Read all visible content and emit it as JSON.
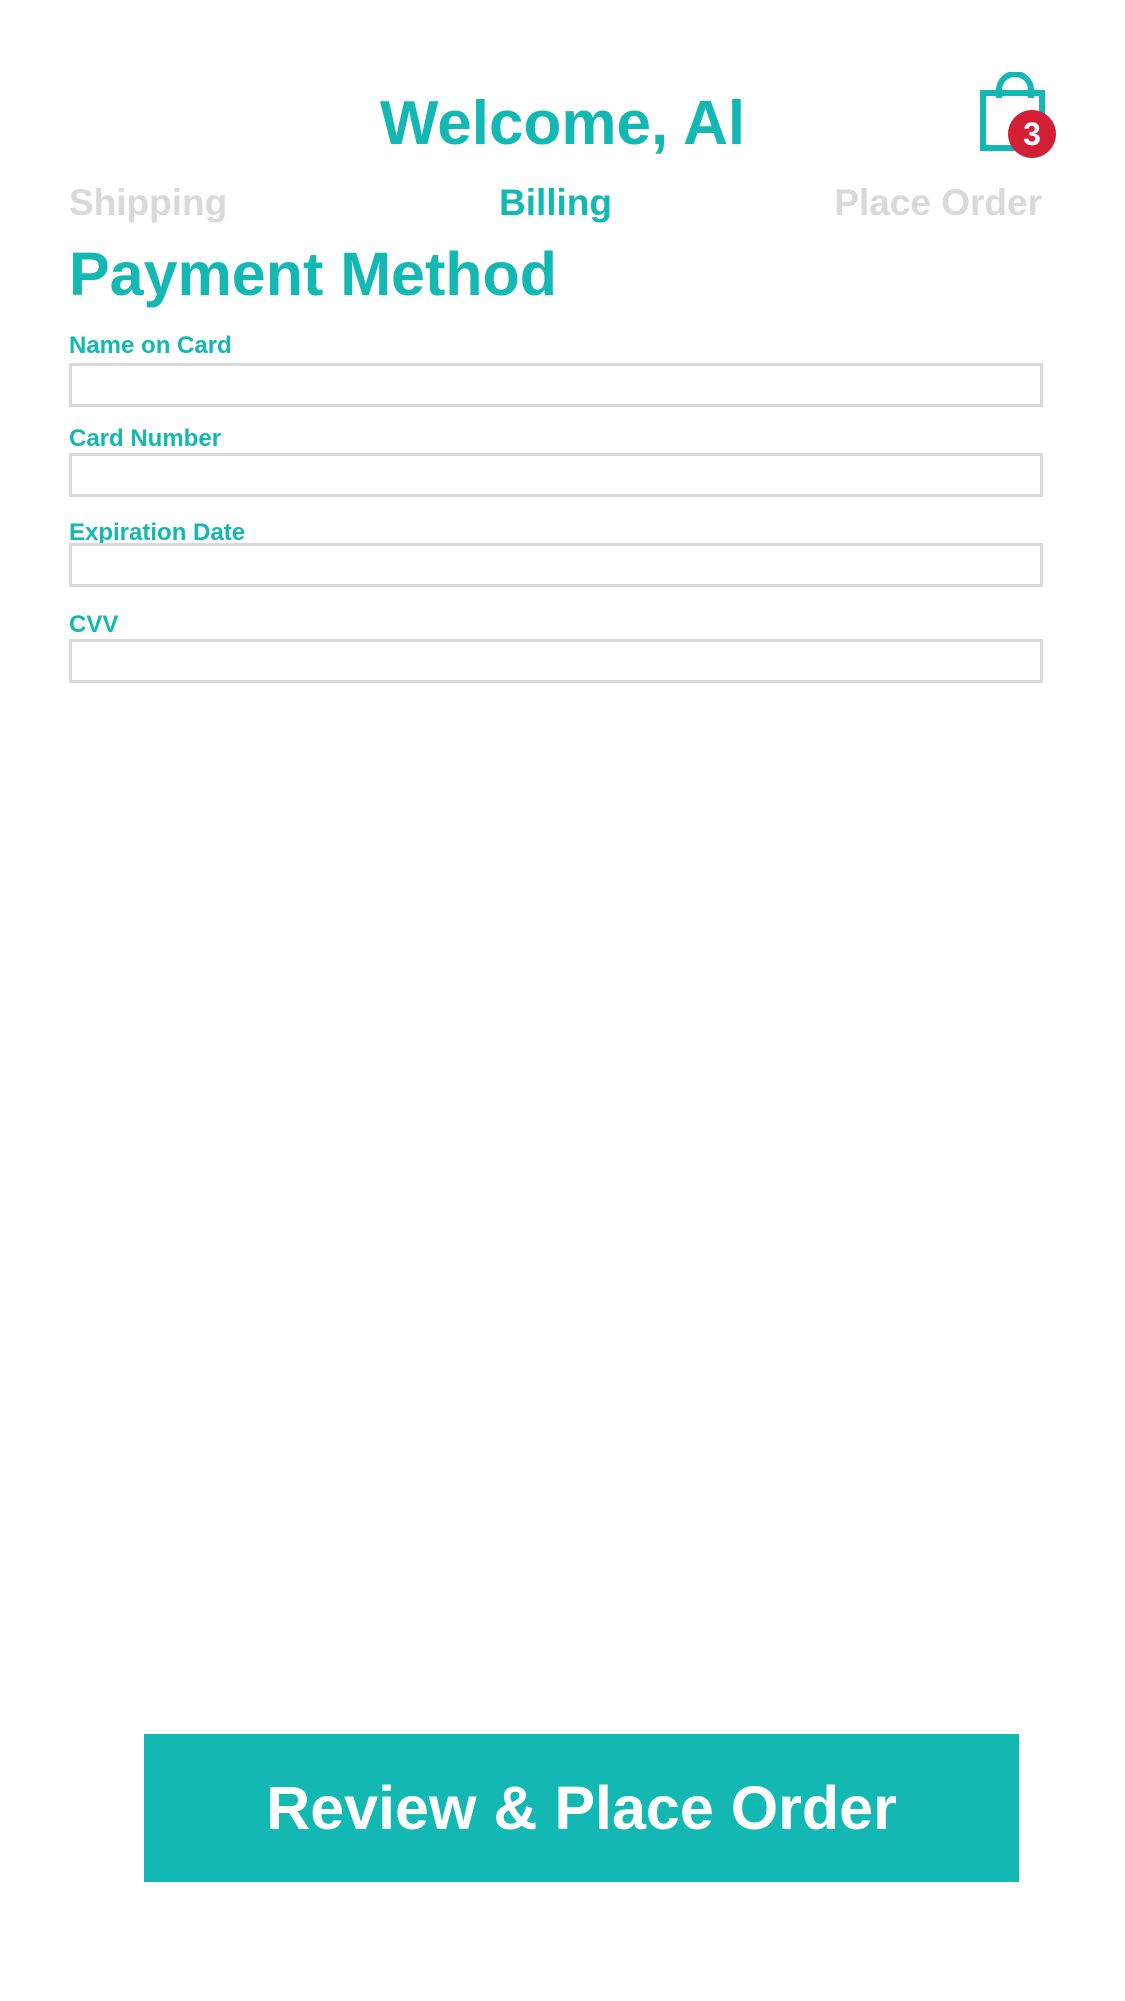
{
  "header": {
    "title": "Welcome, Al",
    "cart_count": "3",
    "cart_icon": "shopping-bag-icon"
  },
  "steps": [
    {
      "label": "Shipping",
      "active": false
    },
    {
      "label": "Billing",
      "active": true
    },
    {
      "label": "Place Order",
      "active": false
    }
  ],
  "payment": {
    "title": "Payment Method",
    "fields": [
      {
        "label": "Name on Card",
        "value": "",
        "placeholder": ""
      },
      {
        "label": "Card Number",
        "value": "",
        "placeholder": ""
      },
      {
        "label": "Expiration Date",
        "value": "",
        "placeholder": ""
      },
      {
        "label": "CVV",
        "value": "",
        "placeholder": ""
      }
    ]
  },
  "footer": {
    "cta_label": "Review & Place Order"
  },
  "colors": {
    "accent": "#12b8b1",
    "inactive_step": "#d9d9d9",
    "badge": "#d21f35",
    "input_border": "#d9d9d9"
  }
}
